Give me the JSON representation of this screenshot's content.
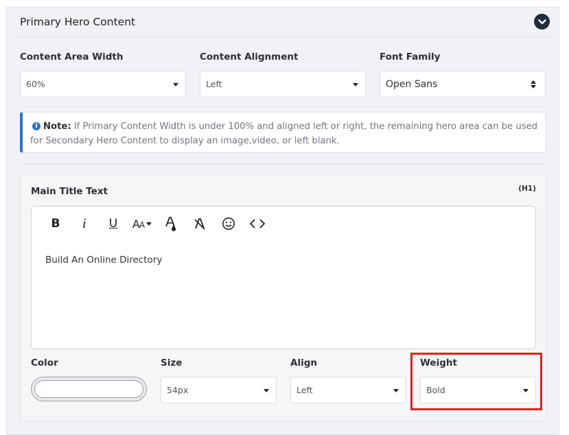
{
  "section": {
    "title": "Primary Hero Content"
  },
  "layout_fields": {
    "content_area_width": {
      "label": "Content Area Width",
      "value": "60%"
    },
    "content_alignment": {
      "label": "Content Alignment",
      "value": "Left"
    },
    "font_family": {
      "label": "Font Family",
      "value": "Open Sans"
    }
  },
  "note": {
    "label": "Note:",
    "text": "If Primary Content Width is under 100% and aligned left or right, the remaining hero area can be used for Secondary Hero Content to display an image,video, or left blank."
  },
  "main_title": {
    "label": "Main Title Text",
    "tag": "(H1)",
    "toolbar": {
      "bold": "B",
      "italic": "i",
      "underline": "U",
      "font_size": "AA",
      "icons": [
        "bold-icon",
        "italic-icon",
        "underline-icon",
        "font-size-icon",
        "text-color-icon",
        "clear-format-icon",
        "emoji-icon",
        "code-icon"
      ]
    },
    "content": "Build An Online Directory"
  },
  "style_fields": {
    "color": {
      "label": "Color",
      "value": "#ffffff"
    },
    "size": {
      "label": "Size",
      "value": "54px"
    },
    "align": {
      "label": "Align",
      "value": "Left"
    },
    "weight": {
      "label": "Weight",
      "value": "Bold"
    }
  },
  "colors": {
    "accent": "#2b73c9",
    "header_button": "#1f2d3d",
    "highlight": "#e02020"
  }
}
